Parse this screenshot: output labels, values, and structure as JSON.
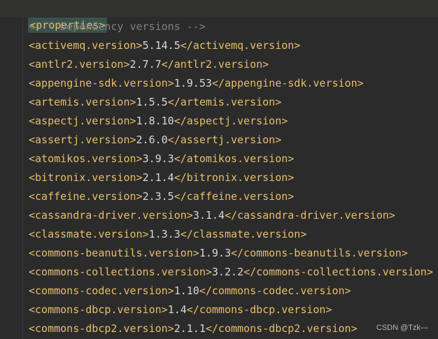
{
  "editor": {
    "root_tag": "<properties>",
    "comment": "<!-- Dependency versions -->",
    "lines": [
      {
        "open": "<activemq.version>",
        "value": "5.14.5",
        "close": "</activemq.version>"
      },
      {
        "open": "<antlr2.version>",
        "value": "2.7.7",
        "close": "</antlr2.version>"
      },
      {
        "open": "<appengine-sdk.version>",
        "value": "1.9.53",
        "close": "</appengine-sdk.version>"
      },
      {
        "open": "<artemis.version>",
        "value": "1.5.5",
        "close": "</artemis.version>"
      },
      {
        "open": "<aspectj.version>",
        "value": "1.8.10",
        "close": "</aspectj.version>"
      },
      {
        "open": "<assertj.version>",
        "value": "2.6.0",
        "close": "</assertj.version>"
      },
      {
        "open": "<atomikos.version>",
        "value": "3.9.3",
        "close": "</atomikos.version>"
      },
      {
        "open": "<bitronix.version>",
        "value": "2.1.4",
        "close": "</bitronix.version>"
      },
      {
        "open": "<caffeine.version>",
        "value": "2.3.5",
        "close": "</caffeine.version>"
      },
      {
        "open": "<cassandra-driver.version>",
        "value": "3.1.4",
        "close": "</cassandra-driver.version>"
      },
      {
        "open": "<classmate.version>",
        "value": "1.3.3",
        "close": "</classmate.version>"
      },
      {
        "open": "<commons-beanutils.version>",
        "value": "1.9.3",
        "close": "</commons-beanutils.version>"
      },
      {
        "open": "<commons-collections.version>",
        "value": "3.2.2",
        "close": "</commons-collections.version>"
      },
      {
        "open": "<commons-codec.version>",
        "value": "1.10",
        "close": "</commons-codec.version>"
      },
      {
        "open": "<commons-dbcp.version>",
        "value": "1.4",
        "close": "</commons-dbcp.version>"
      },
      {
        "open": "<commons-dbcp2.version>",
        "value": "2.1.1",
        "close": "</commons-dbcp2.version>"
      }
    ]
  },
  "watermark": "CSDN @Tzk—",
  "colors": {
    "background": "#2b2b2b",
    "tag": "#e8bf6a",
    "value": "#d8d8d8",
    "comment": "#808080",
    "root_highlight": "#3b514d"
  }
}
